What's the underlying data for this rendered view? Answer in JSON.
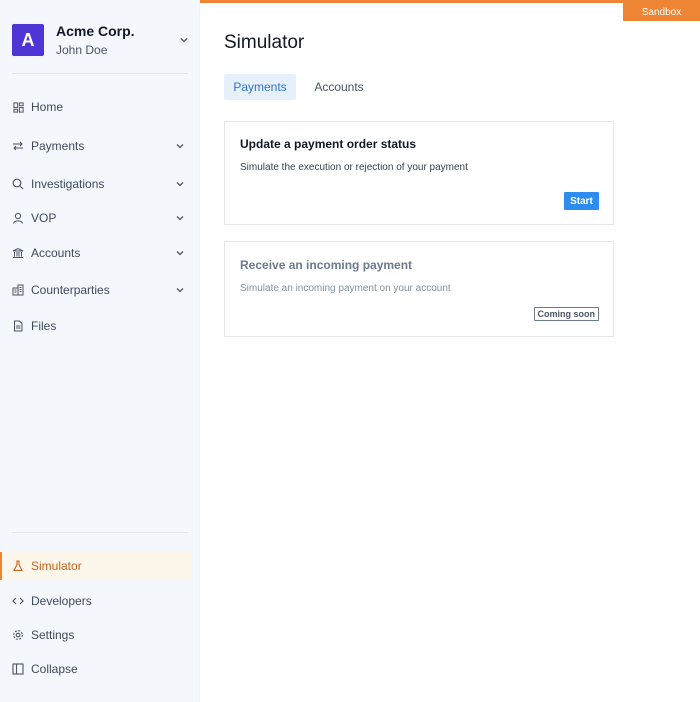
{
  "org": {
    "initial": "A",
    "name": "Acme Corp.",
    "user": "John Doe"
  },
  "sidebar": {
    "items": [
      {
        "label": "Home",
        "icon": "grid-icon",
        "expandable": false
      },
      {
        "label": "Payments",
        "icon": "arrows-exchange-icon",
        "expandable": true
      },
      {
        "label": "Investigations",
        "icon": "search-icon",
        "expandable": true
      },
      {
        "label": "VOP",
        "icon": "user-icon",
        "expandable": true
      },
      {
        "label": "Accounts",
        "icon": "bank-icon",
        "expandable": true
      },
      {
        "label": "Counterparties",
        "icon": "buildings-icon",
        "expandable": true
      },
      {
        "label": "Files",
        "icon": "file-icon",
        "expandable": false
      }
    ],
    "bottom_items": [
      {
        "label": "Simulator",
        "icon": "flask-icon",
        "active": true
      },
      {
        "label": "Developers",
        "icon": "code-icon",
        "active": false
      },
      {
        "label": "Settings",
        "icon": "gear-icon",
        "active": false
      },
      {
        "label": "Collapse",
        "icon": "sidebar-collapse-icon",
        "active": false
      }
    ]
  },
  "environment_badge": "Sandbox",
  "page": {
    "title": "Simulator",
    "tabs": [
      {
        "label": "Payments",
        "active": true
      },
      {
        "label": "Accounts",
        "active": false
      }
    ],
    "cards": [
      {
        "title": "Update a payment order status",
        "description": "Simulate the execution or rejection of your payment",
        "action_label": "Start",
        "enabled": true
      },
      {
        "title": "Receive an incoming payment",
        "description": "Simulate an incoming payment on your account",
        "badge_label": "Coming soon",
        "enabled": false
      }
    ]
  },
  "colors": {
    "accent": "#ee8534",
    "brand_avatar": "#4f35d6",
    "primary_button": "#2d8cf0",
    "active_tab_bg": "#e6f0fb"
  }
}
